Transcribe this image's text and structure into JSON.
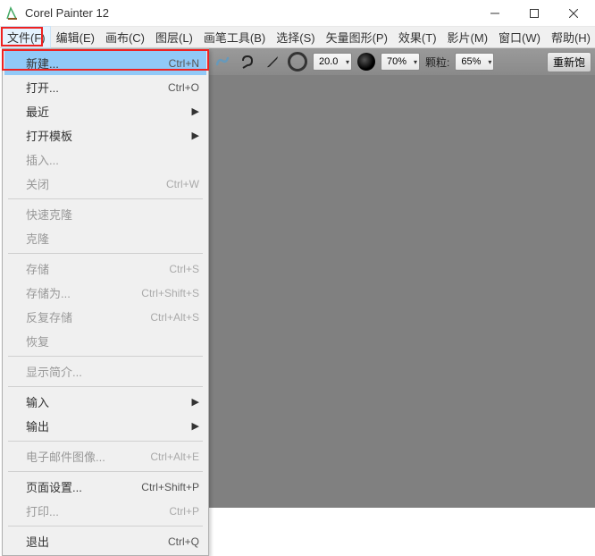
{
  "title": "Corel Painter 12",
  "menubar": [
    {
      "label": "文件(F)"
    },
    {
      "label": "编辑(E)"
    },
    {
      "label": "画布(C)"
    },
    {
      "label": "图层(L)"
    },
    {
      "label": "画笔工具(B)"
    },
    {
      "label": "选择(S)"
    },
    {
      "label": "矢量图形(P)"
    },
    {
      "label": "效果(T)"
    },
    {
      "label": "影片(M)"
    },
    {
      "label": "窗口(W)"
    },
    {
      "label": "帮助(H)"
    }
  ],
  "dropdown": {
    "items": [
      {
        "label": "新建...",
        "shortcut": "Ctrl+N",
        "highlighted": true
      },
      {
        "label": "打开...",
        "shortcut": "Ctrl+O"
      },
      {
        "label": "最近",
        "submenu": true
      },
      {
        "label": "打开模板",
        "submenu": true
      },
      {
        "label": "插入...",
        "disabled": true
      },
      {
        "label": "关闭",
        "shortcut": "Ctrl+W",
        "disabled": true
      },
      {
        "sep": true
      },
      {
        "label": "快速克隆",
        "disabled": true
      },
      {
        "label": "克隆",
        "disabled": true
      },
      {
        "sep": true
      },
      {
        "label": "存储",
        "shortcut": "Ctrl+S",
        "disabled": true
      },
      {
        "label": "存储为...",
        "shortcut": "Ctrl+Shift+S",
        "disabled": true
      },
      {
        "label": "反复存储",
        "shortcut": "Ctrl+Alt+S",
        "disabled": true
      },
      {
        "label": "恢复",
        "disabled": true
      },
      {
        "sep": true
      },
      {
        "label": "显示简介...",
        "disabled": true
      },
      {
        "sep": true
      },
      {
        "label": "输入",
        "submenu": true
      },
      {
        "label": "输出",
        "submenu": true
      },
      {
        "sep": true
      },
      {
        "label": "电子邮件图像...",
        "shortcut": "Ctrl+Alt+E",
        "disabled": true
      },
      {
        "sep": true
      },
      {
        "label": "页面设置...",
        "shortcut": "Ctrl+Shift+P"
      },
      {
        "label": "打印...",
        "shortcut": "Ctrl+P",
        "disabled": true
      },
      {
        "sep": true
      },
      {
        "label": "退出",
        "shortcut": "Ctrl+Q"
      }
    ]
  },
  "toolbar": {
    "size_value": "20.0",
    "opacity_value": "70%",
    "grain_label": "颗粒:",
    "grain_value": "65%",
    "refill_label": "重新饱"
  }
}
